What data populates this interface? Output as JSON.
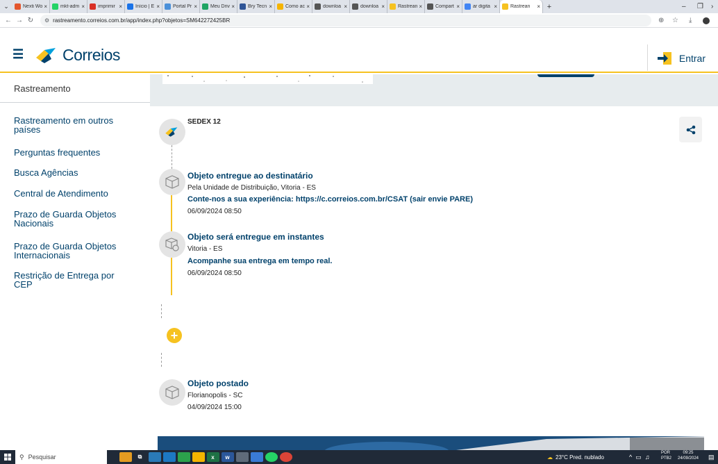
{
  "browser": {
    "tabs": [
      {
        "label": "Nexti Wo",
        "icon": "nexti-icon",
        "color": "#e4572e"
      },
      {
        "label": "mkt-adm",
        "icon": "whatsapp-icon",
        "color": "#25d366"
      },
      {
        "label": "imprimir",
        "icon": "gmail-icon",
        "color": "#d93025"
      },
      {
        "label": "Início | E",
        "icon": "edge-icon",
        "color": "#1a73e8"
      },
      {
        "label": "Portal Pr",
        "icon": "portal-icon",
        "color": "#4a90d9"
      },
      {
        "label": "Meu Driv",
        "icon": "drive-icon",
        "color": "#1fa463"
      },
      {
        "label": "Bry Tecn",
        "icon": "bry-icon",
        "color": "#2f5597"
      },
      {
        "label": "Como ac",
        "icon": "folder-icon",
        "color": "#f5b400"
      },
      {
        "label": "downloa",
        "icon": "globe-icon",
        "color": "#555555"
      },
      {
        "label": "downloa",
        "icon": "globe-icon",
        "color": "#555555"
      },
      {
        "label": "Rastrean",
        "icon": "correios-icon",
        "color": "#f6c220"
      },
      {
        "label": "Compart",
        "icon": "globe-icon",
        "color": "#555555"
      },
      {
        "label": "ar digita",
        "icon": "google-icon",
        "color": "#4285f4"
      },
      {
        "label": "Rastrean",
        "icon": "correios-icon",
        "color": "#f6c220",
        "active": true
      }
    ],
    "new_tab": "+",
    "minimize": "–",
    "restore": "❐",
    "url": "rastreamento.correios.com.br/app/index.php?objetos=SM642272425BR"
  },
  "header": {
    "logo_text": "Correios",
    "login_label": "Entrar"
  },
  "sidebar": {
    "title": "Rastreamento",
    "links": [
      "Rastreamento em outros países",
      "Perguntas frequentes",
      "Busca Agências",
      "Central de Atendimento",
      "Prazo de Guarda Objetos Nacionais",
      "Prazo de Guarda Objetos Internacionais",
      "Restrição de Entrega por CEP"
    ]
  },
  "tracking": {
    "service": "SEDEX 12",
    "events": [
      {
        "title": "Objeto entregue ao destinatário",
        "location": "Pela Unidade de Distribuição, Vitoria - ES",
        "note_prefix": "Conte-nos a sua experiência: ",
        "note_link": "https://c.correios.com.br/CSAT",
        "note_suffix": " (sair envie PARE)",
        "datetime": "06/09/2024 08:50"
      },
      {
        "title": "Objeto será entregue em instantes",
        "location": "Vitoria - ES",
        "note": "Acompanhe sua entrega em tempo real.",
        "datetime": "06/09/2024 08:50"
      },
      {
        "title": "Objeto postado",
        "location": "Florianopolis - SC",
        "datetime": "04/09/2024 15:00"
      }
    ]
  },
  "taskbar": {
    "search_placeholder": "Pesquisar",
    "weather": "23°C  Pred. nublado",
    "language": "POR",
    "keyboard": "PTB2",
    "time": "09:25",
    "date": "24/09/2024"
  },
  "colors": {
    "brand_blue": "#00416b",
    "brand_yellow": "#f6c220"
  }
}
